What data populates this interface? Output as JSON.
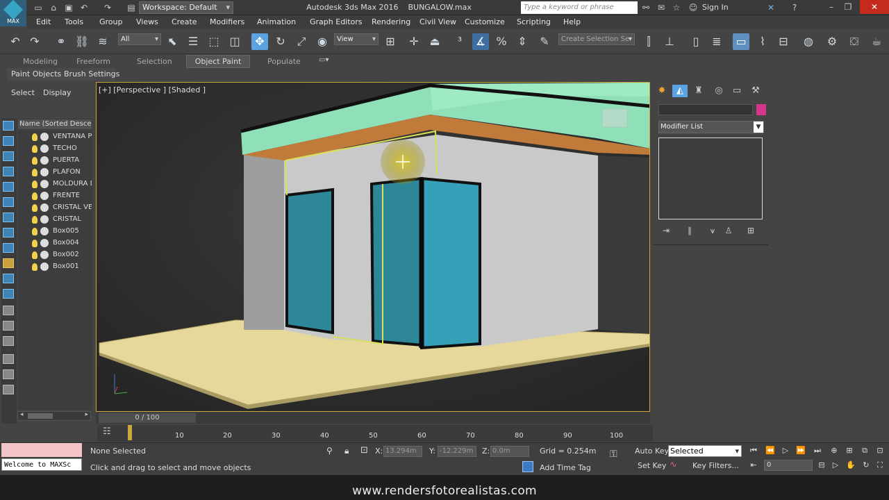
{
  "titlebar": {
    "logo_text": "MAX",
    "workspace": "Workspace: Default",
    "app_title": "Autodesk 3ds Max 2016",
    "file_name": "BUNGALOW.max",
    "search_placeholder": "Type a keyword or phrase",
    "sign_in": "Sign In"
  },
  "menu": [
    "Edit",
    "Tools",
    "Group",
    "Views",
    "Create",
    "Modifiers",
    "Animation",
    "Graph Editors",
    "Rendering",
    "Civil View",
    "Customize",
    "Scripting",
    "Help"
  ],
  "toolbar": {
    "selection_filter": "All",
    "ref_coord": "View",
    "named_selection": "Create Selection Se"
  },
  "ribbon": {
    "tabs": [
      "Modeling",
      "Freeform",
      "Selection",
      "Object Paint",
      "Populate"
    ],
    "active_tab": "Object Paint",
    "sub_items": [
      "Paint Objects",
      "Brush Settings"
    ]
  },
  "scene_explorer": {
    "tabs": [
      "Select",
      "Display"
    ],
    "column_header": "Name (Sorted Descend",
    "items": [
      "VENTANA P",
      "TECHO",
      "PUERTA",
      "PLAFON",
      "MOLDURA D",
      "FRENTE",
      "CRISTAL VE",
      "CRISTAL",
      "Box005",
      "Box004",
      "Box002",
      "Box001"
    ]
  },
  "viewport": {
    "label": "[+] [Perspective ] [Shaded ]"
  },
  "command_panel": {
    "modifier_list": "Modifier List",
    "name_color": "#d6368c"
  },
  "timeline": {
    "slider": "0 / 100",
    "ticks": [
      "10",
      "20",
      "30",
      "40",
      "50",
      "60",
      "70",
      "80",
      "90",
      "100"
    ]
  },
  "status": {
    "maxscript": "Welcome to MAXSc",
    "selection": "None Selected",
    "prompt": "Click and drag to select and move objects",
    "x_label": "X:",
    "x_value": "13.294m",
    "y_label": "Y:",
    "y_value": "-12.229m",
    "z_label": "Z:",
    "z_value": "0.0m",
    "grid": "Grid = 0.254m",
    "add_time_tag": "Add Time Tag",
    "auto_key": "Auto Key",
    "set_key": "Set Key",
    "key_mode": "Selected",
    "key_filters": "Key Filters...",
    "frame": "0"
  },
  "footer": {
    "watermark": "www.rendersfotorealistas.com"
  },
  "colors": {
    "accent": "#5aa3e0",
    "viewport_border": "#c9a83b",
    "roof_top": "#8fe0b8",
    "roof_fascia": "#c07a3a",
    "glass": "#2e97ad",
    "floor": "#e6d79a",
    "wall": "#c8c8c8"
  }
}
